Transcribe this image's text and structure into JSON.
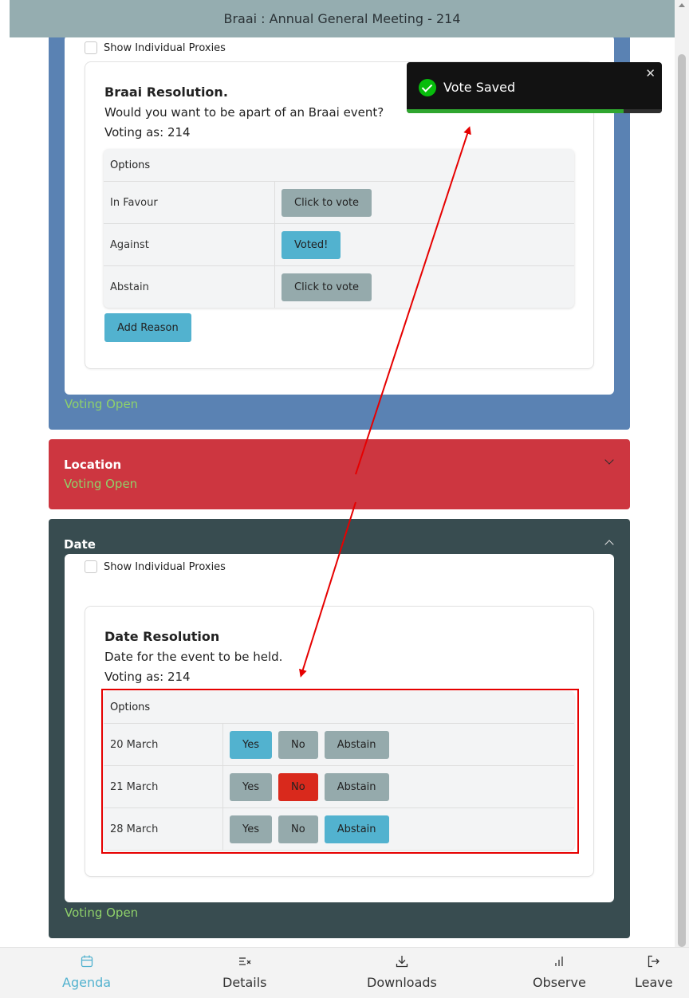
{
  "header": {
    "title": "Braai : Annual General Meeting - 214"
  },
  "toast": {
    "message": "Vote Saved",
    "close": "✕",
    "progress": 0.85
  },
  "braai": {
    "proxies_label": "Show Individual Proxies",
    "resolution": {
      "title": "Braai Resolution.",
      "description": "Would you want to be apart of an Braai event?",
      "voting_as": "Voting as: 214",
      "options_header": "Options",
      "options": [
        {
          "label": "In Favour",
          "button": "Click to vote"
        },
        {
          "label": "Against",
          "button": "Voted!"
        },
        {
          "label": "Abstain",
          "button": "Click to vote"
        }
      ],
      "add_reason": "Add Reason"
    },
    "status": "Voting Open"
  },
  "location": {
    "title": "Location",
    "status": "Voting Open"
  },
  "date": {
    "title": "Date",
    "proxies_label": "Show Individual Proxies",
    "resolution": {
      "title": "Date Resolution",
      "description": "Date for the event to be held.",
      "voting_as": "Voting as: 214",
      "options_header": "Options",
      "buttons": {
        "yes": "Yes",
        "no": "No",
        "abstain": "Abstain"
      },
      "options": [
        {
          "label": "20 March",
          "selected": "yes"
        },
        {
          "label": "21 March",
          "selected": "no"
        },
        {
          "label": "28 March",
          "selected": "abstain"
        }
      ]
    },
    "status": "Voting Open"
  },
  "nav": {
    "items": [
      {
        "label": "Agenda",
        "icon": "calendar-icon",
        "active": true
      },
      {
        "label": "Details",
        "icon": "list-x-icon"
      },
      {
        "label": "Downloads",
        "icon": "download-icon"
      },
      {
        "label": "Observe",
        "icon": "bar-chart-icon"
      },
      {
        "label": "Leave",
        "icon": "logout-icon"
      }
    ]
  },
  "colors": {
    "voted_blue": "#52b2cf",
    "vote_no_red": "#d9291c",
    "vote_grey": "#95aaac",
    "voting_open_green": "#8fd16a"
  }
}
